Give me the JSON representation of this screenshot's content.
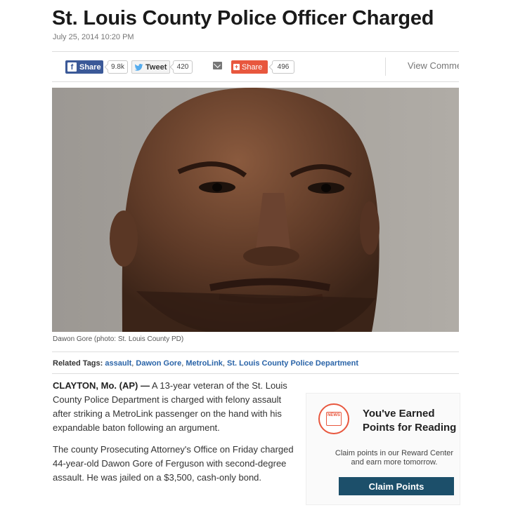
{
  "article": {
    "title": "St. Louis County Police Officer Charged",
    "dateline": "July 25, 2014 10:20 PM",
    "caption": "Dawon Gore (photo: St. Louis County PD)",
    "related_tags_label": "Related Tags:",
    "tags": [
      "assault",
      "Dawon Gore",
      "MetroLink",
      "St. Louis County Police Department"
    ],
    "dateline_location": "CLAYTON, Mo. (AP) —",
    "paragraph1_rest": " A 13-year veteran of the St. Louis County Police Department is charged with felony assault after striking a MetroLink passenger on the hand with his expandable baton following an argument.",
    "paragraph2": "The county Prosecuting Attorney's Office on Friday charged 44-year-old Dawon Gore of Ferguson with second-degree assault. He was jailed on a $3,500, cash-only bond."
  },
  "share": {
    "facebook_label": "Share",
    "facebook_count": "9.8k",
    "tweet_label": "Tweet",
    "tweet_count": "420",
    "share_label": "Share",
    "share_count": "496",
    "view_comments": "View Comments",
    "icons": [
      "facebook-icon",
      "twitter-bird-icon",
      "mail-icon",
      "plus-icon"
    ],
    "colors": {
      "facebook": "#3b5998",
      "share": "#e8573e"
    }
  },
  "promo": {
    "heading_line1": "You've Earned",
    "heading_line2": "Points for Reading",
    "sub_line1": "Claim points in our Reward Center",
    "sub_line2": "and earn more tomorrow.",
    "button": "Claim Points",
    "badge_text": "NEWS",
    "colors": {
      "button": "#1c4f6a",
      "badge": "#e8573e"
    }
  }
}
